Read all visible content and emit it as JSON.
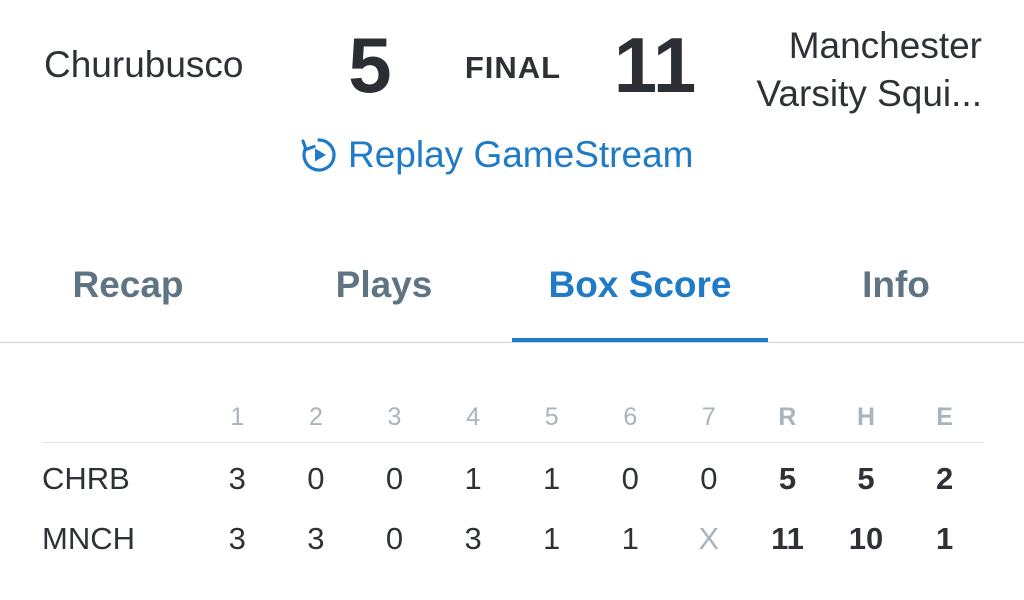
{
  "header": {
    "away_name": "Churubusco",
    "away_score": "5",
    "status": "FINAL",
    "home_score": "11",
    "home_name_line1": "Manchester",
    "home_name_line2": "Varsity Squi..."
  },
  "replay": {
    "label": "Replay GameStream",
    "icon": "replay-icon"
  },
  "tabs": [
    {
      "label": "Recap",
      "active": false
    },
    {
      "label": "Plays",
      "active": false
    },
    {
      "label": "Box Score",
      "active": true
    },
    {
      "label": "Info",
      "active": false
    }
  ],
  "box_score": {
    "columns": [
      "1",
      "2",
      "3",
      "4",
      "5",
      "6",
      "7",
      "R",
      "H",
      "E"
    ],
    "rows": [
      {
        "team": "CHRB",
        "values": [
          "3",
          "0",
          "0",
          "1",
          "1",
          "0",
          "0",
          "5",
          "5",
          "2"
        ]
      },
      {
        "team": "MNCH",
        "values": [
          "3",
          "3",
          "0",
          "3",
          "1",
          "1",
          "X",
          "11",
          "10",
          "1"
        ]
      }
    ]
  },
  "colors": {
    "accent": "#1f7ac8",
    "text": "#2e3236",
    "muted": "#a9b4bc",
    "tab_inactive": "#5f7482"
  }
}
